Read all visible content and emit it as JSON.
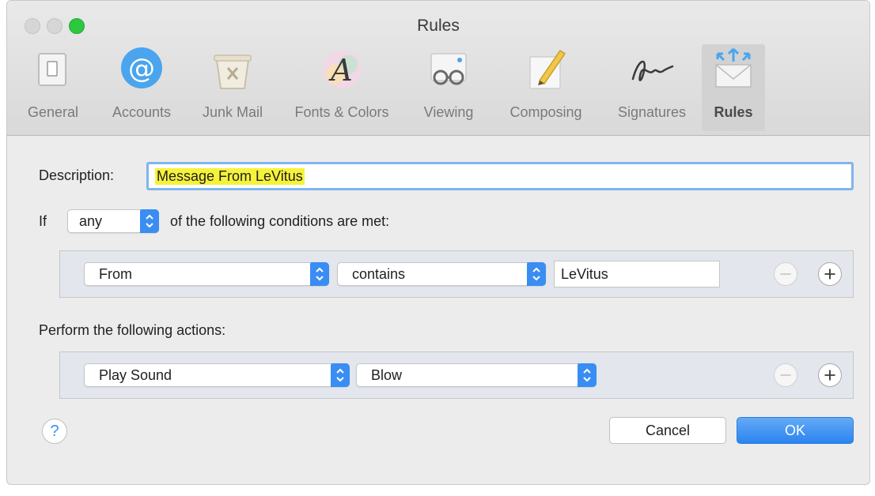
{
  "window": {
    "title": "Rules"
  },
  "toolbar": {
    "items": [
      {
        "label": "General",
        "icon": "general-switch-icon"
      },
      {
        "label": "Accounts",
        "icon": "at-sign-icon"
      },
      {
        "label": "Junk Mail",
        "icon": "junk-trash-icon"
      },
      {
        "label": "Fonts & Colors",
        "icon": "fonts-colors-icon"
      },
      {
        "label": "Viewing",
        "icon": "viewing-glasses-icon"
      },
      {
        "label": "Composing",
        "icon": "composing-pencil-icon"
      },
      {
        "label": "Signatures",
        "icon": "signature-icon"
      },
      {
        "label": "Rules",
        "icon": "rules-envelope-icon"
      }
    ],
    "active": "Rules"
  },
  "rule": {
    "description_label": "Description:",
    "description_value": "Message From LeVitus",
    "if_label": "If",
    "match_value": "any",
    "conditions_text": "of the following conditions are met:",
    "condition": {
      "field": "From",
      "operator": "contains",
      "value": "LeVitus"
    },
    "actions_label": "Perform the following actions:",
    "action": {
      "type": "Play Sound",
      "value": "Blow"
    }
  },
  "buttons": {
    "help": "?",
    "cancel": "Cancel",
    "ok": "OK",
    "remove": "−",
    "add": "+"
  },
  "colors": {
    "accent": "#3a8df2",
    "highlight": "#f6f23a",
    "zoom_green": "#2cc840"
  }
}
